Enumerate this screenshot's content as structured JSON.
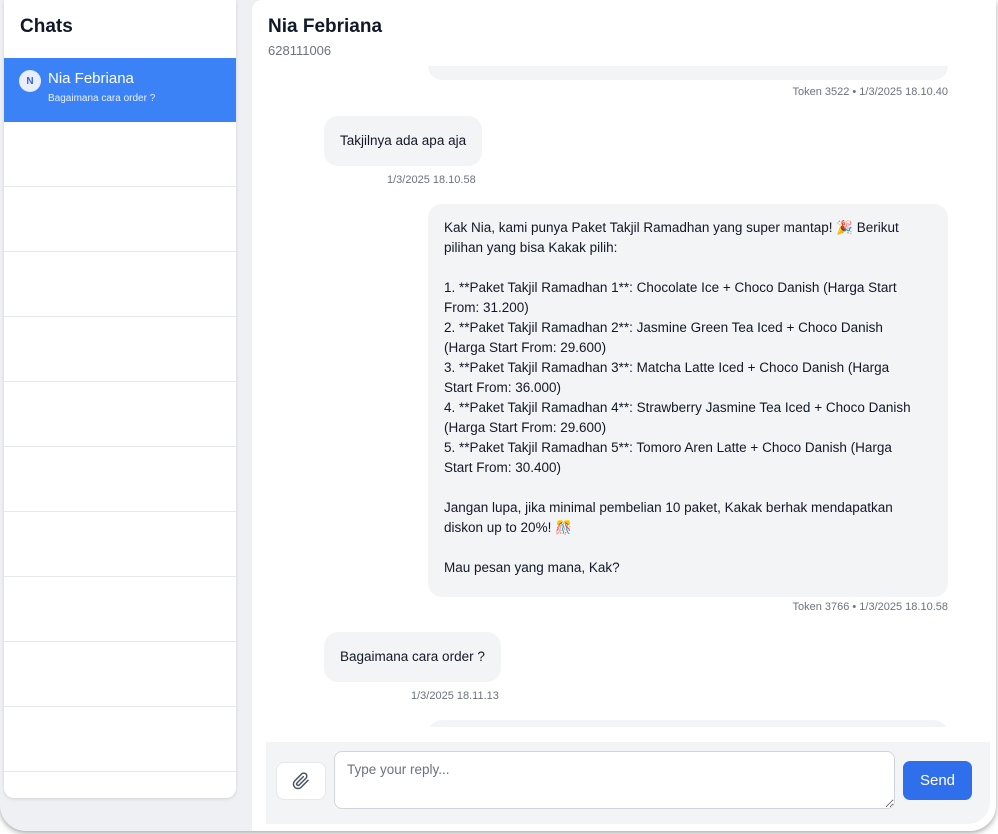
{
  "sidebar": {
    "title": "Chats",
    "chats": [
      {
        "avatar_initial": "N",
        "name": "Nia Febriana",
        "preview": "Bagaimana cara order ?"
      }
    ]
  },
  "header": {
    "name": "Nia Febriana",
    "phone": "628111006"
  },
  "messages": {
    "m0": {
      "meta": "Token 3522 • 1/3/2025 18.10.40"
    },
    "m1": {
      "text": "Takjilnya ada apa aja",
      "meta": "1/3/2025 18.10.58"
    },
    "m2": {
      "lines": [
        "Kak Nia, kami punya Paket Takjil Ramadhan yang super mantap! 🎉 Berikut",
        "pilihan yang bisa Kakak pilih:",
        "",
        "1. **Paket Takjil Ramadhan 1**: Chocolate Ice + Choco Danish (Harga Start",
        "From: 31.200)",
        "2. **Paket Takjil Ramadhan 2**: Jasmine Green Tea Iced + Choco Danish",
        "(Harga Start From: 29.600)",
        "3. **Paket Takjil Ramadhan 3**: Matcha Latte Iced + Choco Danish (Harga",
        "Start From: 36.000)",
        "4. **Paket Takjil Ramadhan 4**: Strawberry Jasmine Tea Iced + Choco Danish",
        "(Harga Start From: 29.600)",
        "5. **Paket Takjil Ramadhan 5**: Tomoro Aren Latte + Choco Danish (Harga",
        "Start From: 30.400)",
        "",
        "Jangan lupa, jika minimal pembelian 10 paket, Kakak berhak mendapatkan",
        "diskon up to 20%! 🎊",
        "",
        "Mau pesan yang mana, Kak?"
      ],
      "meta": "Token 3766 • 1/3/2025 18.10.58"
    },
    "m3": {
      "text": "Bagaimana cara order ?",
      "meta": "1/3/2025 18.11.13"
    }
  },
  "composer": {
    "placeholder": "Type your reply...",
    "send_label": "Send",
    "attach_icon": "paperclip-icon"
  },
  "colors": {
    "accent": "#3b82f6",
    "send_button": "#2f6fec",
    "bubble": "#f3f4f6"
  }
}
